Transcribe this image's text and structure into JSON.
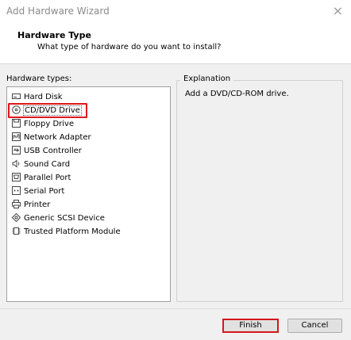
{
  "window": {
    "title": "Add Hardware Wizard",
    "close_glyph": "×"
  },
  "header": {
    "title": "Hardware Type",
    "subtitle": "What type of hardware do you want to install?"
  },
  "hardware": {
    "label": "Hardware types:",
    "selected": "CD/DVD Drive",
    "items": [
      {
        "label": "Hard Disk",
        "icon": "hard-disk-icon"
      },
      {
        "label": "CD/DVD Drive",
        "icon": "cd-dvd-icon"
      },
      {
        "label": "Floppy Drive",
        "icon": "floppy-icon"
      },
      {
        "label": "Network Adapter",
        "icon": "network-adapter-icon"
      },
      {
        "label": "USB Controller",
        "icon": "usb-icon"
      },
      {
        "label": "Sound Card",
        "icon": "sound-card-icon"
      },
      {
        "label": "Parallel Port",
        "icon": "parallel-port-icon"
      },
      {
        "label": "Serial Port",
        "icon": "serial-port-icon"
      },
      {
        "label": "Printer",
        "icon": "printer-icon"
      },
      {
        "label": "Generic SCSI Device",
        "icon": "scsi-icon"
      },
      {
        "label": "Trusted Platform Module",
        "icon": "tpm-icon"
      }
    ]
  },
  "explanation": {
    "label": "Explanation",
    "text": "Add a DVD/CD-ROM drive."
  },
  "buttons": {
    "finish": "Finish",
    "cancel": "Cancel"
  },
  "colors": {
    "highlight": "#e0161c",
    "background": "#f0f0f0"
  }
}
